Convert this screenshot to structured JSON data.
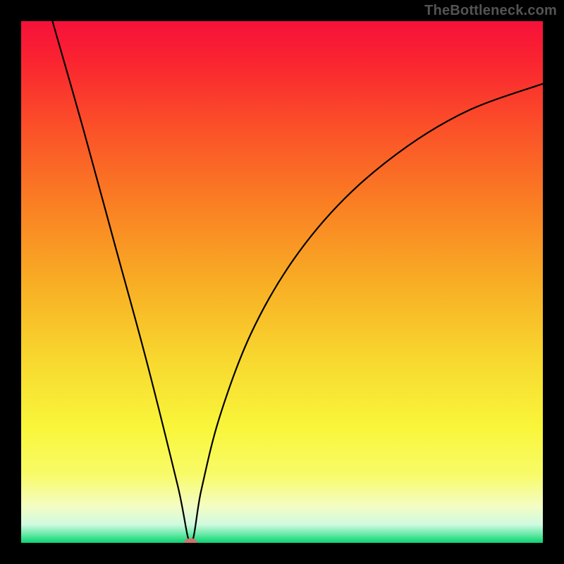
{
  "watermark": "TheBottleneck.com",
  "chart_data": {
    "type": "line",
    "title": "",
    "xlabel": "",
    "ylabel": "",
    "xlim": [
      0,
      100
    ],
    "ylim": [
      0,
      100
    ],
    "grid": false,
    "legend": false,
    "background": {
      "style": "vertical-gradient",
      "stops": [
        {
          "pos": 0.0,
          "color": "#f61139"
        },
        {
          "pos": 0.08,
          "color": "#fa2530"
        },
        {
          "pos": 0.2,
          "color": "#fb4f29"
        },
        {
          "pos": 0.35,
          "color": "#fa7f23"
        },
        {
          "pos": 0.5,
          "color": "#f8ad24"
        },
        {
          "pos": 0.65,
          "color": "#f8d82f"
        },
        {
          "pos": 0.78,
          "color": "#f9f63a"
        },
        {
          "pos": 0.87,
          "color": "#f8fb69"
        },
        {
          "pos": 0.93,
          "color": "#f3fdc4"
        },
        {
          "pos": 0.965,
          "color": "#d0fae0"
        },
        {
          "pos": 0.982,
          "color": "#70ebac"
        },
        {
          "pos": 1.0,
          "color": "#09d372"
        }
      ]
    },
    "curve": {
      "stroke": "#000000",
      "stroke_width": 2.2,
      "minimum_x": 32.5,
      "segments": [
        {
          "from": {
            "x": 6.0,
            "y": 100.0
          },
          "to": {
            "x": 32.5,
            "y": 0.0
          },
          "shape": "near-linear-steep-descent"
        },
        {
          "from": {
            "x": 32.5,
            "y": 0.0
          },
          "to": {
            "x": 100.0,
            "y": 88.0
          },
          "shape": "concave-sqrt-like-rise"
        }
      ],
      "sampled_points": [
        {
          "x": 6.0,
          "y": 100.0
        },
        {
          "x": 12.0,
          "y": 79.0
        },
        {
          "x": 18.0,
          "y": 57.0
        },
        {
          "x": 24.0,
          "y": 35.0
        },
        {
          "x": 30.0,
          "y": 11.0
        },
        {
          "x": 32.5,
          "y": 0.0
        },
        {
          "x": 34.5,
          "y": 10.0
        },
        {
          "x": 38.0,
          "y": 24.0
        },
        {
          "x": 44.0,
          "y": 40.0
        },
        {
          "x": 52.0,
          "y": 54.0
        },
        {
          "x": 62.0,
          "y": 66.0
        },
        {
          "x": 74.0,
          "y": 76.0
        },
        {
          "x": 86.0,
          "y": 83.0
        },
        {
          "x": 100.0,
          "y": 88.0
        }
      ]
    },
    "marker": {
      "x": 32.5,
      "y": 0.0,
      "rx": 1.3,
      "ry": 0.9,
      "fill": "#c8766c"
    }
  }
}
